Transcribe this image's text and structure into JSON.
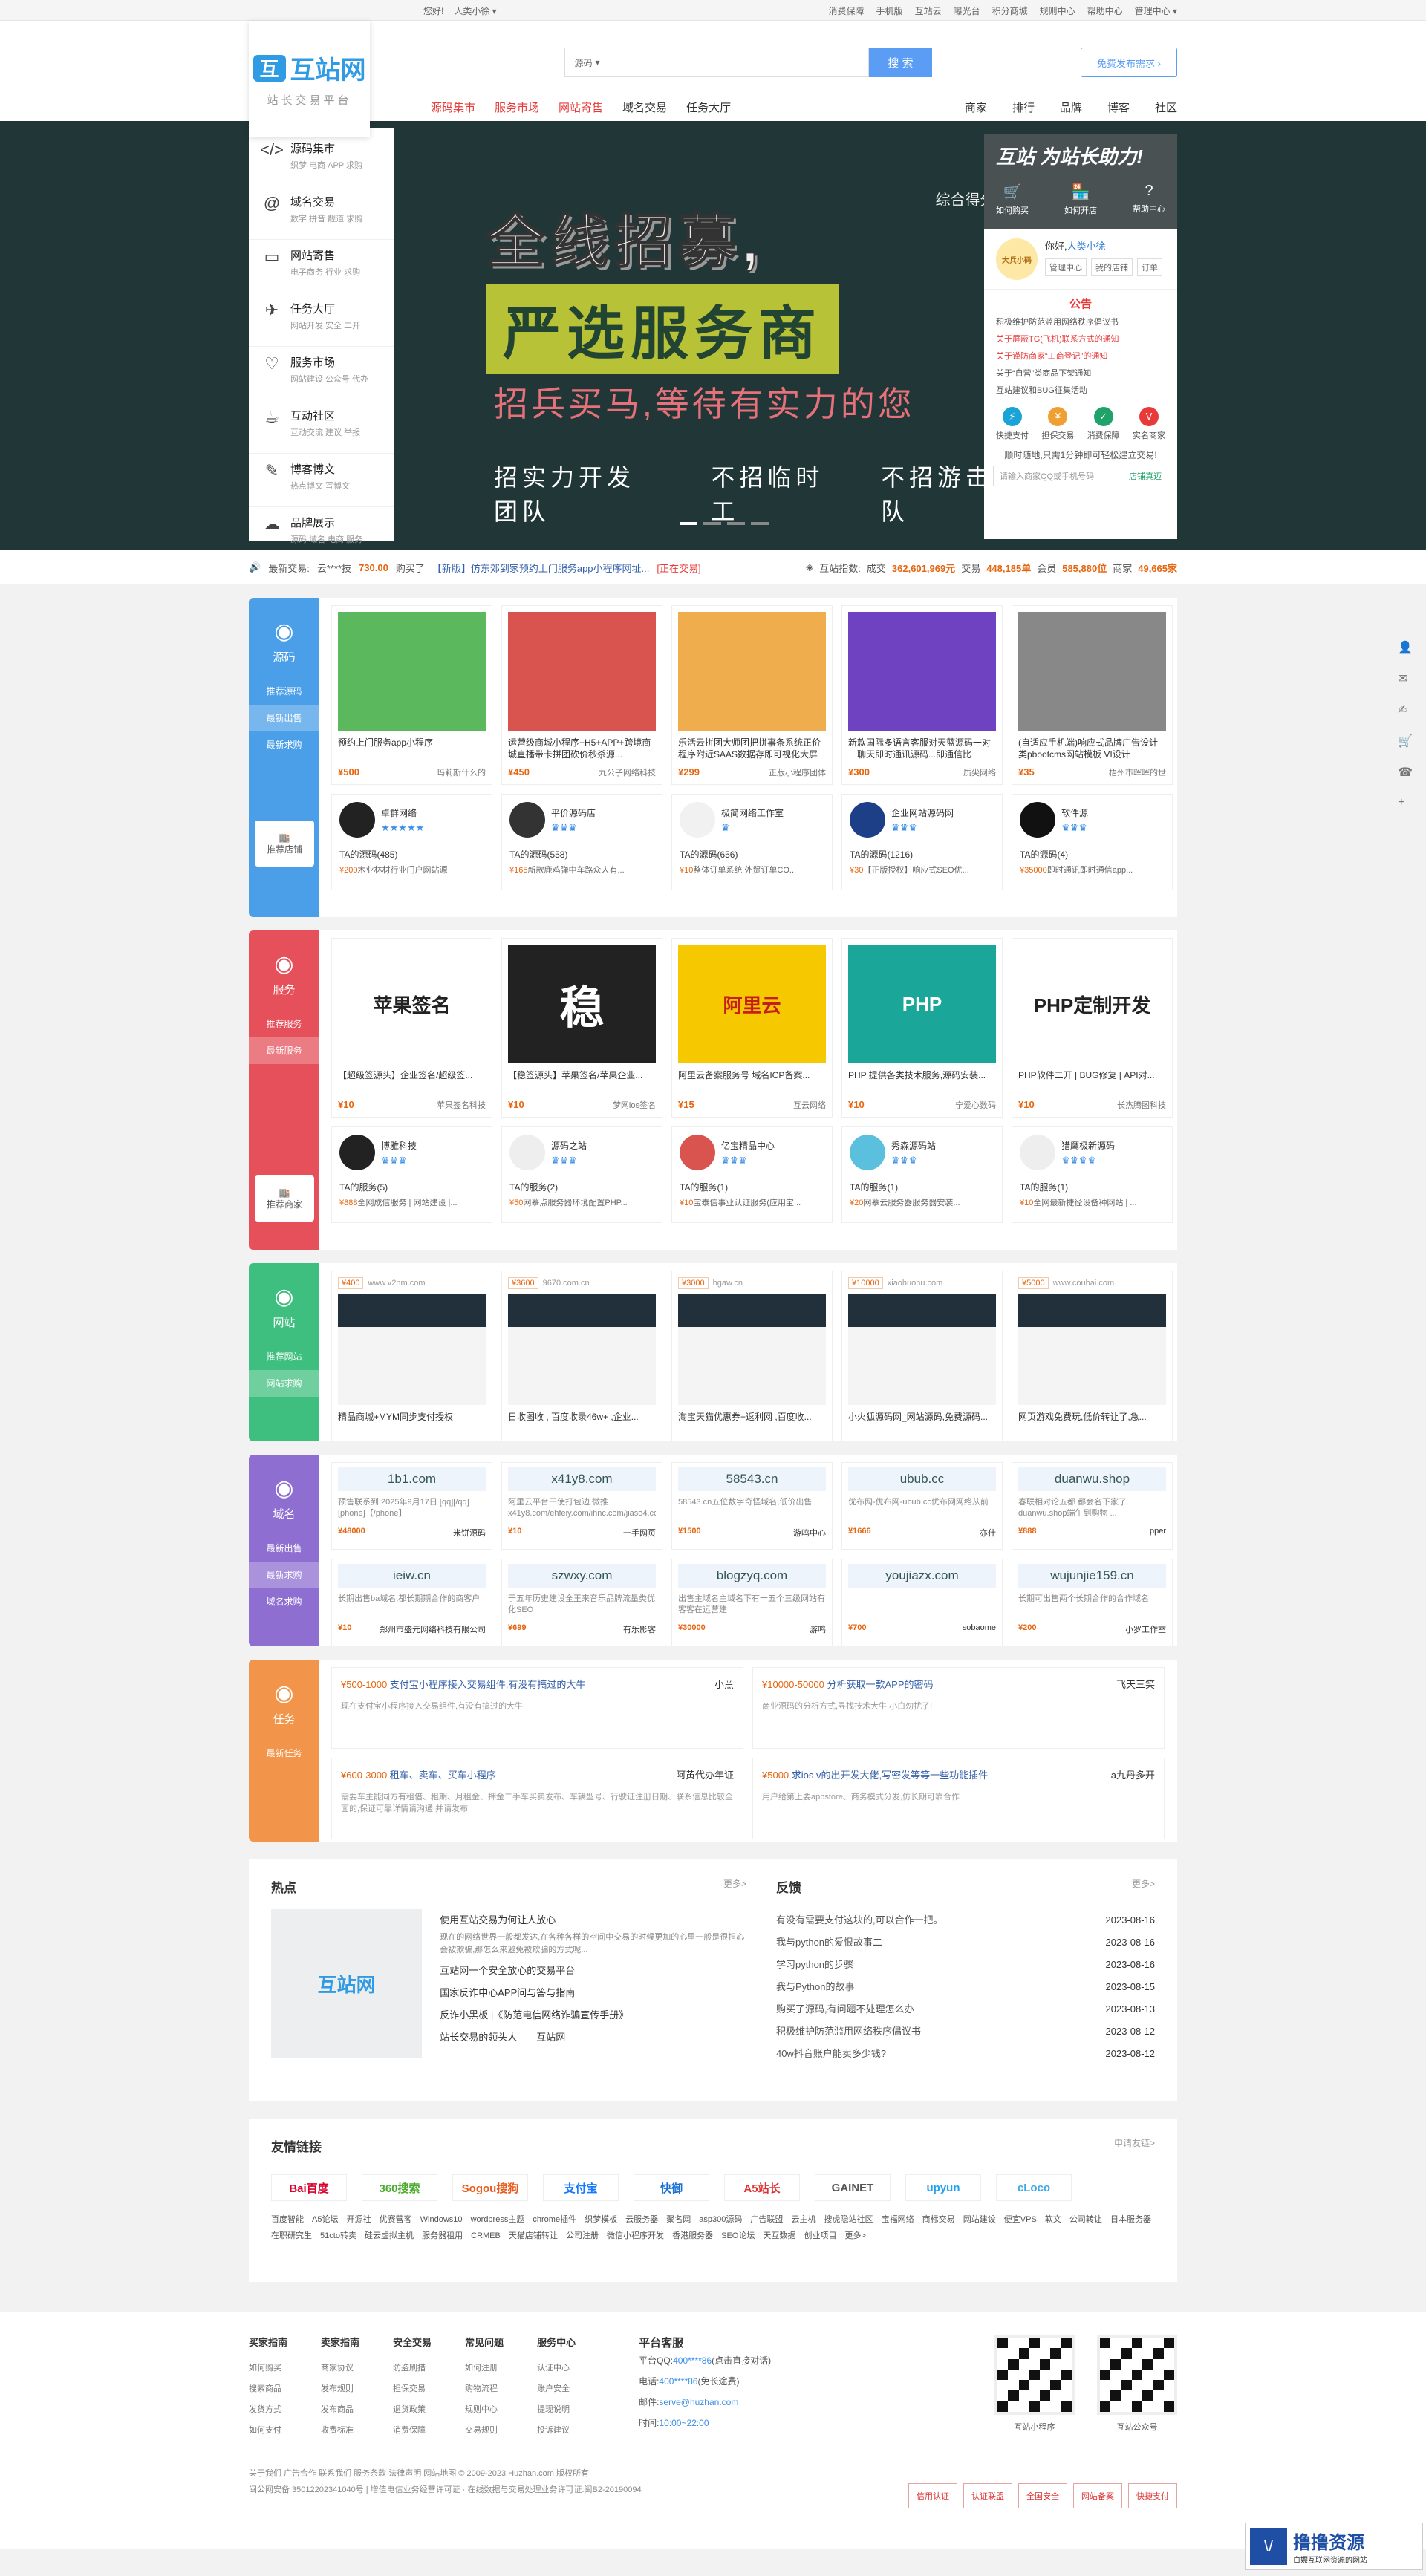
{
  "topbar": {
    "login": "您好!",
    "user": "人类小徐 ▾",
    "links": [
      "消费保障",
      "手机版",
      "互站云",
      "曝光台",
      "积分商城",
      "规则中心",
      "帮助中心",
      "管理中心 ▾"
    ]
  },
  "logo": {
    "name": "互站网",
    "slogan": "站长交易平台"
  },
  "search": {
    "select": "源码",
    "placeholder": "",
    "button": "搜 索",
    "publish": "免费发布需求 ›"
  },
  "nav": {
    "main": [
      "源码集市",
      "服务市场",
      "网站寄售",
      "域名交易",
      "任务大厅"
    ],
    "right": [
      "商家",
      "排行",
      "品牌",
      "博客",
      "社区"
    ]
  },
  "cats": [
    {
      "icon": "</>",
      "t": "源码集市",
      "s": "织梦  电商  APP  求购"
    },
    {
      "icon": "@",
      "t": "域名交易",
      "s": "数字  拼音  靓道  求购"
    },
    {
      "icon": "▭",
      "t": "网站寄售",
      "s": "电子商务  行业  求购"
    },
    {
      "icon": "✈",
      "t": "任务大厅",
      "s": "网站开发  安全  二开"
    },
    {
      "icon": "♡",
      "t": "服务市场",
      "s": "网站建设  公众号  代办"
    },
    {
      "icon": "☕",
      "t": "互动社区",
      "s": "互动交流  建议  举报"
    },
    {
      "icon": "✎",
      "t": "博客博文",
      "s": "热点博文  写博文"
    },
    {
      "icon": "☁",
      "t": "品牌展示",
      "s": "源码  域名  电商  服务"
    }
  ],
  "hero": {
    "l1": "全线招募,",
    "l2": "严选服务商",
    "l3": "招兵买马,等待有实力的您",
    "l4": [
      "招实力开发团队",
      "不招临时工",
      "不招游击队"
    ],
    "score": "综合得分:"
  },
  "side": {
    "title": "互站 为站长助力!",
    "ops": [
      "如何购买",
      "如何开店",
      "帮助中心"
    ],
    "hi": "你好,",
    "name": "人类小徐",
    "btns": [
      "管理中心",
      "我的店铺",
      "订单"
    ],
    "ann": "公告",
    "notices": [
      "积极维护防范滥用网络秩序倡议书",
      "关于屏蔽TG(飞机)联系方式的通知",
      "关于谨防商家“工商登记”的通知",
      "关于“自营”类商品下架通知",
      "互站建议和BUG征集活动"
    ],
    "svc": [
      "快捷支付",
      "担保交易",
      "消费保障",
      "实名商家"
    ],
    "cta": "顺时随地,只需1分钟即可轻松建立交易!",
    "phone": "请输入商家QQ或手机号码",
    "phone_btn": "店铺真迈"
  },
  "ticker": {
    "label": "最新交易:",
    "user": "云****技",
    "price": "730.00",
    "act": "购买了",
    "item": "【新版】仿东郊到家预约上门服务app小程序网址...",
    "tag": "[正在交易]",
    "idx_label": "互站指数:",
    "deal": "成交",
    "deal_v": "362,601,969元",
    "tx": "交易",
    "tx_v": "448,185单",
    "mem": "会员",
    "mem_v": "585,880位",
    "shop": "商家",
    "shop_v": "49,665家"
  },
  "f1": {
    "name": "源码",
    "subs": [
      "推荐源码",
      "最新出售",
      "最新求购"
    ],
    "store": "推荐店铺",
    "cards": [
      {
        "t": "预约上门服务app小程序",
        "p": "¥500",
        "s": "玛莉斯什么的",
        "c": "#5cb85c"
      },
      {
        "t": "运营级商城小程序+H5+APP+跨境商城直播带卡拼团砍价秒杀源...",
        "p": "¥450",
        "s": "九公子网络科技",
        "c": "#d9534f"
      },
      {
        "t": "乐活云拼团大师团把拼事条系统正价程序附近SAAS数据存即可视化大屏",
        "p": "¥299",
        "s": "正版小程序团体",
        "c": "#f0ad4e"
      },
      {
        "t": "新款国际多语言客服对天蓝源码一对一聊天即时通讯源码...即通信比",
        "p": "¥300",
        "s": "质尖网络",
        "c": "#6f42c1"
      },
      {
        "t": "(自适应手机端)响应式品牌广告设计类pbootcms网站模板 VI设计",
        "p": "¥35",
        "s": "梧州市晖晖的世",
        "c": "#888"
      }
    ],
    "shops": [
      {
        "n": "卓群网络",
        "star": "★★★★★",
        "cnt": "TA的源码(485)",
        "d": "¥200",
        "dt": "木业林材行业门户网站源",
        "c": "#222"
      },
      {
        "n": "平价源码店",
        "star": "♛♛♛",
        "cnt": "TA的源码(558)",
        "d": "¥165",
        "dt": "新款鹿鸡弹中车路众人有...",
        "c": "#333"
      },
      {
        "n": "极简网络工作室",
        "star": "♛",
        "cnt": "TA的源码(656)",
        "d": "¥10",
        "dt": "整体订单系统 外贸订单CO...",
        "c": "#f1f1f1"
      },
      {
        "n": "企业网站源码网",
        "star": "♛♛♛",
        "cnt": "TA的源码(1216)",
        "d": "¥30",
        "dt": "【正版授权】响应式SEO优...",
        "c": "#1d3f88"
      },
      {
        "n": "软件源",
        "star": "♛♛♛",
        "cnt": "TA的源码(4)",
        "d": "¥35000",
        "dt": "即时通讯即时通信app...",
        "c": "#111"
      }
    ]
  },
  "f2": {
    "name": "服务",
    "subs": [
      "推荐服务",
      "最新服务"
    ],
    "store": "推荐商家",
    "cards": [
      {
        "t": "【超级签源头】企业签名/超级签...",
        "p": "¥10",
        "s": "苹果签名科技",
        "img": "苹果签名",
        "c": "#fff"
      },
      {
        "t": "【稳签源头】苹果签名/苹果企业...",
        "p": "¥10",
        "s": "梦网ios签名",
        "img": "稳",
        "c": "#222"
      },
      {
        "t": "阿里云备案服务号 域名ICP备案...",
        "p": "¥15",
        "s": "互云网络",
        "img": "阿里云",
        "c": "#f5c800"
      },
      {
        "t": "PHP 提供各类技术服务,源码安装...",
        "p": "¥10",
        "s": "宁爱心数码",
        "img": "PHP",
        "c": "#1aa79a"
      },
      {
        "t": "PHP软件二开 | BUG修复 | API对...",
        "p": "¥10",
        "s": "长杰腾图科技",
        "img": "PHP定制开发",
        "c": "#fff"
      }
    ],
    "shops": [
      {
        "n": "博雅科技",
        "star": "♛♛♛",
        "cnt": "TA的服务(5)",
        "d": "¥888",
        "dt": "全网成信服务 | 网站建设 |...",
        "c": "#222"
      },
      {
        "n": "源码之站",
        "star": "♛♛♛",
        "cnt": "TA的服务(2)",
        "d": "¥50",
        "dt": "网摹点服务器环境配置PHP...",
        "c": "#eee"
      },
      {
        "n": "亿宝精品中心",
        "star": "♛♛♛",
        "cnt": "TA的服务(1)",
        "d": "¥10",
        "dt": "宝泰信事业认证服务(应用宝...",
        "c": "#d9534f"
      },
      {
        "n": "秀森源码站",
        "star": "♛♛♛",
        "cnt": "TA的服务(1)",
        "d": "¥20",
        "dt": "网摹云服务器服务器安装...",
        "c": "#5bc0de"
      },
      {
        "n": "猎鹰极新源码",
        "star": "♛♛♛♛",
        "cnt": "TA的服务(1)",
        "d": "¥10",
        "dt": "全网最新捷径设备种网站 | ...",
        "c": "#eee"
      }
    ]
  },
  "f3": {
    "name": "网站",
    "subs": [
      "推荐网站",
      "网站求购"
    ],
    "cards": [
      {
        "price": "¥400",
        "url": "www.v2nm.com",
        "t": "精品商城+MYM同步支付授权"
      },
      {
        "price": "¥3600",
        "url": "9670.com.cn",
        "t": "日收图收 , 百度收录46w+ ,企业..."
      },
      {
        "price": "¥3000",
        "url": "bgaw.cn",
        "t": "淘宝天猫优惠券+返利网 ,百度收..."
      },
      {
        "price": "¥10000",
        "url": "xiaohuohu.com",
        "t": "小火狐源码网_网站源码,免费源码..."
      },
      {
        "price": "¥5000",
        "url": "www.coubai.com",
        "t": "网页游戏免费玩,低价转让了,急..."
      }
    ]
  },
  "f4": {
    "name": "域名",
    "subs": [
      "最新出售",
      "最新求购",
      "域名求购"
    ],
    "cards": [
      {
        "d": "1b1.com",
        "ds": "预售联系到:2025年9月17日 [qq][/qq] [phone]【/phone】",
        "p": "¥48000",
        "s": "米饼源码"
      },
      {
        "d": "x41y8.com",
        "ds": "阿里云平台干使打包边 微推x41y8.com/ehfeiy.com/ihnc.com/jiaso4.com",
        "p": "¥10",
        "s": "一手网页"
      },
      {
        "d": "58543.cn",
        "ds": "58543.cn五位数字奇怪域名,低价出售",
        "p": "¥1500",
        "s": "游鸣中心"
      },
      {
        "d": "ubub.cc",
        "ds": "优布网-优布网-ubub.cc优布网网络从前",
        "p": "¥1666",
        "s": "亦什"
      },
      {
        "d": "duanwu.shop",
        "ds": "春联相对论五都 都会名下家了duanwu.shop端午到购物 ...",
        "p": "¥888",
        "s": "pper"
      },
      {
        "d": "ieiw.cn",
        "ds": "长期出售ba域名,都长期期合作的商客户",
        "p": "¥10",
        "s": "郑州市盛元网络科技有限公司"
      },
      {
        "d": "szwxy.com",
        "ds": "于五年历史建设全王来音乐品牌流量类优化SEO",
        "p": "¥699",
        "s": "有乐影客"
      },
      {
        "d": "blogzyq.com",
        "ds": "出售主域名主域名下有十五个三级网站有客客在运营建",
        "p": "¥30000",
        "s": "游鸣"
      },
      {
        "d": "youjiazx.com",
        "ds": "",
        "p": "¥700",
        "s": "sobaome"
      },
      {
        "d": "wujunjie159.cn",
        "ds": "长期可出售两个长期合作的合作域名",
        "p": "¥200",
        "s": "小罗工作室"
      }
    ]
  },
  "f5": {
    "name": "任务",
    "subs": [
      "最新任务"
    ],
    "tasks": [
      {
        "p": "¥500-1000",
        "t": "支付宝小程序接入交易组件,有没有搞过的大牛",
        "u": "小黑",
        "d": "现在支付宝小程序接入交易组件,有没有搞过的大牛"
      },
      {
        "p": "¥10000-50000",
        "t": "分析获取一款APP的密码",
        "u": "飞天三笑",
        "d": "商业源码的分析方式,寻找技术大牛,小白勿扰了!"
      },
      {
        "p": "¥600-3000",
        "t": "租车、卖车、买车小程序",
        "u": "阿黄代办年证",
        "d": "需要车主能同方有租借、租期、月租金、押金二手车买卖发布、车辆型号、行驶证注册日期、联系信息比较全面的,保证可靠详情请沟通,并请发布"
      },
      {
        "p": "¥5000",
        "t": "求ios v的出开发大佬,写密发等等一些功能插件",
        "u": "a九丹多开",
        "d": "用户给第上要appstore、商务模式分发,仿长期可靠合作"
      }
    ]
  },
  "news": {
    "hot": "热点",
    "more": "更多>",
    "fb": "反馈",
    "more2": "更多>",
    "pic": "互站网",
    "hot_items": [
      "使用互站交易为何让人放心",
      "国家反诈中心APP问与答与指南",
      "反诈小黑板 |《防范电信网络诈骗宣传手册》",
      "站长交易的领头人——互站网"
    ],
    "hot_lead": "现在的网络世界一般都发达,在各种各样的空间中交易的时候更加的心里一般是很担心会被欺骗,那怎么来避免被欺骗的方式呢...",
    "hot_sub": "互站网一个安全放心的交易平台",
    "fb_items": [
      {
        "t": "有没有需要支付这块的,可以合作一把。",
        "d": "2023-08-16"
      },
      {
        "t": "我与python的爱恨故事二",
        "d": "2023-08-16"
      },
      {
        "t": "学习python的步骤",
        "d": "2023-08-16"
      },
      {
        "t": "我与Python的故事",
        "d": "2023-08-15"
      },
      {
        "t": "购买了源码,有问题不处理怎么办",
        "d": "2023-08-13"
      },
      {
        "t": "积极维护防范滥用网络秩序倡议书",
        "d": "2023-08-12"
      },
      {
        "t": "40w抖音账户能卖多少钱?",
        "d": "2023-08-12"
      }
    ]
  },
  "links": {
    "title": "友情链接",
    "apply": "申请友链>",
    "logos": [
      "Bai百度",
      "360搜索",
      "Sogou搜狗",
      "支付宝",
      "快御",
      "A5站长",
      "GAINET",
      "upyun",
      "cLoco"
    ],
    "text": "百度智能 A5论坛 开源社 优赛营客 Windows10 wordpress主题 chrome插件 织梦模板 云服务器 聚名网 asp300源码 广告联盟 云主机 搜虎隐站社区 宝福网络 商标交易 网站建设 便宜VPS 软文 公司转让 日本服务器 在职研究生 51cto转卖 硅云虚拟主机 服务器租用 CRMEB 天猫店铺转让 公司注册 微信小程序开发 香港服务器 SEO论坛 天互数据 创业项目 更多>"
  },
  "footer": {
    "cols": [
      {
        "h": "买家指南",
        "i": [
          "如何购买",
          "搜索商品",
          "发货方式",
          "如何支付"
        ]
      },
      {
        "h": "卖家指南",
        "i": [
          "商家协议",
          "发布规则",
          "发布商品",
          "收费标准"
        ]
      },
      {
        "h": "安全交易",
        "i": [
          "防盗刷措",
          "担保交易",
          "退货政策",
          "消费保障"
        ]
      },
      {
        "h": "常见问题",
        "i": [
          "如何注册",
          "购物流程",
          "规则中心",
          "交易规则"
        ]
      },
      {
        "h": "服务中心",
        "i": [
          "认证中心",
          "账户安全",
          "提现说明",
          "投诉建议"
        ]
      }
    ],
    "svc_title": "平台客服",
    "qq": "平台QQ:",
    "qq_v": "400****86",
    "qq_n": "(点击直接对话)",
    "tel": "电话:",
    "tel_v": "400****86",
    "tel_n": "(免长途费)",
    "mail": "邮件:",
    "mail_v": "serve@huzhan.com",
    "time": "时间:",
    "time_v": "10:00~22:00",
    "qr": [
      "互站小程序",
      "互站公众号"
    ],
    "bot1": "关于我们  广告合作  联系我们  服务条款  法律声明  网站地图",
    "copy": "© 2009-2023 Huzhan.com 版权所有",
    "bot2": "闽公网安备 35012202341040号 | 增值电信业务经营许可证 · 在线数据与交易处理业务许可证:闽B2-20190094",
    "badges": [
      "信用认证",
      "认证联盟",
      "全国安全",
      "网站备案",
      "快捷支付"
    ]
  },
  "wm": {
    "t": "撸撸资源",
    "s": "白嫖互联网资源的网站"
  }
}
